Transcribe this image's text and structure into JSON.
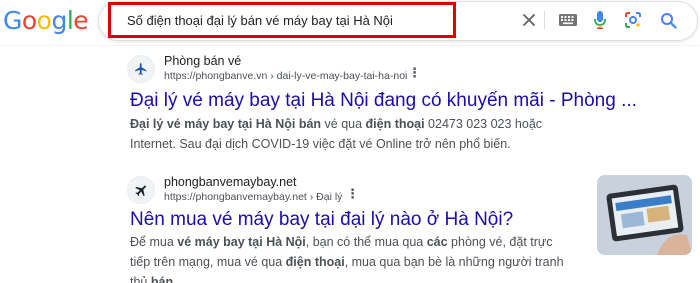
{
  "logo": {
    "letters": [
      "G",
      "o",
      "o",
      "g",
      "l",
      "e"
    ],
    "colors": [
      "#4285F4",
      "#EA4335",
      "#FBBC05",
      "#4285F4",
      "#34A853",
      "#EA4335"
    ]
  },
  "search": {
    "query": "Số điện thoại đại lý bán vé máy bay tại Hà Nội",
    "highlight_color": "#e00000"
  },
  "icons": {
    "clear": "close-icon",
    "keyboard": "keyboard-icon",
    "mic": "microphone-icon",
    "lens": "google-lens-icon",
    "search": "search-icon"
  },
  "results": [
    {
      "site_name": "Phòng bán vé",
      "url": "https://phongbanve.vn › dai-ly-ve-may-bay-tai-ha-noi",
      "title": "Đại lý vé máy bay tại Hà Nội đang có khuyến mãi - Phòng ...",
      "snippet": [
        {
          "t": "Đại lý vé máy bay tại Hà Nội bán",
          "b": true
        },
        {
          "t": " vé qua ",
          "b": false
        },
        {
          "t": "điện thoại",
          "b": true
        },
        {
          "t": " 02473 023 023 hoặc Internet. Sau đại dịch COVID-19 việc đặt vé Online trở nên phổ biến.",
          "b": false
        }
      ]
    },
    {
      "site_name": "phongbanvemaybay.net",
      "url": "https://phongbanvemaybay.net › Đại lý",
      "title": "Nên mua vé máy bay tại đại lý nào ở Hà Nội?",
      "snippet": [
        {
          "t": "Để mua ",
          "b": false
        },
        {
          "t": "vé máy bay tại Hà Nội",
          "b": true
        },
        {
          "t": ", bạn có thể mua qua ",
          "b": false
        },
        {
          "t": "các",
          "b": true
        },
        {
          "t": " phòng vé, đặt trực tiếp trên mạng, mua vé qua ",
          "b": false
        },
        {
          "t": "điện thoại",
          "b": true
        },
        {
          "t": ", mua qua bạn bè là những người tranh thủ ",
          "b": false
        },
        {
          "t": "bán",
          "b": true
        },
        {
          "t": " ...",
          "b": false
        }
      ]
    }
  ]
}
